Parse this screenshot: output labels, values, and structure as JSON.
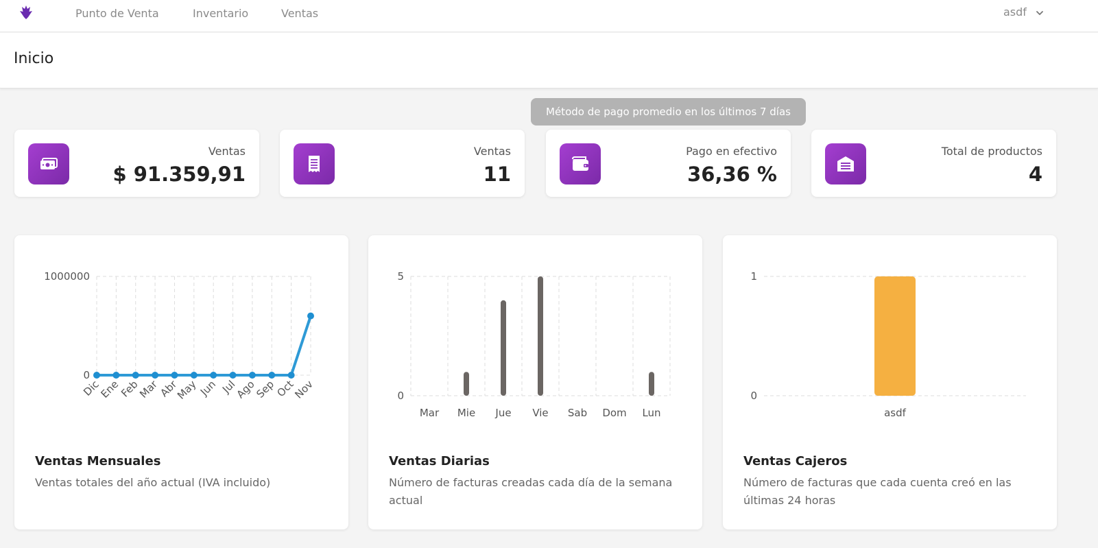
{
  "nav": {
    "items": [
      {
        "label": "Punto de Venta"
      },
      {
        "label": "Inventario"
      },
      {
        "label": "Ventas"
      }
    ],
    "user": "asdf"
  },
  "page": {
    "title": "Inicio"
  },
  "tooltip": "Método de pago promedio en los últimos 7 días",
  "stats": [
    {
      "label": "Ventas",
      "value": "$ 91.359,91",
      "icon": "money-icon"
    },
    {
      "label": "Ventas",
      "value": "11",
      "icon": "receipt-icon"
    },
    {
      "label": "Pago en efectivo",
      "value": "36,36 %",
      "icon": "wallet-icon"
    },
    {
      "label": "Total de productos",
      "value": "4",
      "icon": "warehouse-icon"
    }
  ],
  "colors": {
    "accent": "#8e35bd",
    "line": "#2e9ad6",
    "bar_daily": "#6b6663",
    "bar_cashier": "#f5b041"
  },
  "cards": [
    {
      "title": "Ventas Mensuales",
      "description": "Ventas totales del año actual (IVA incluido)"
    },
    {
      "title": "Ventas Diarias",
      "description": "Número de facturas creadas cada día de la semana actual"
    },
    {
      "title": "Ventas Cajeros",
      "description": "Número de facturas que cada cuenta creó en las últimas 24 horas"
    }
  ],
  "chart_data": [
    {
      "type": "line",
      "categories": [
        "Dic",
        "Ene",
        "Feb",
        "Mar",
        "Abr",
        "May",
        "Jun",
        "Jul",
        "Ago",
        "Sep",
        "Oct",
        "Nov"
      ],
      "values": [
        0,
        0,
        0,
        0,
        0,
        0,
        0,
        0,
        0,
        0,
        0,
        600000
      ],
      "ylim": [
        0,
        1000000
      ],
      "yticks": [
        "0",
        "1000000"
      ],
      "grid": true
    },
    {
      "type": "bar",
      "categories": [
        "Mar",
        "Mie",
        "Jue",
        "Vie",
        "Sab",
        "Dom",
        "Lun"
      ],
      "values": [
        0,
        1,
        4,
        5,
        0,
        0,
        1
      ],
      "ylim": [
        0,
        5
      ],
      "yticks": [
        "0",
        "5"
      ],
      "grid": true
    },
    {
      "type": "bar",
      "categories": [
        "asdf"
      ],
      "values": [
        1
      ],
      "ylim": [
        0,
        1
      ],
      "yticks": [
        "0",
        "1"
      ],
      "grid": true
    }
  ]
}
